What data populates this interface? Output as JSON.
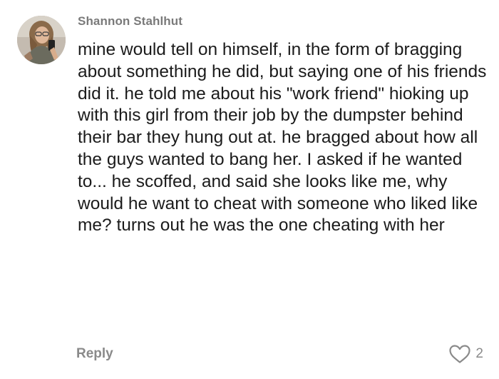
{
  "comment": {
    "author": "Shannon Stahlhut",
    "body": "mine would tell on himself, in the form of bragging about something he did, but saying one of his friends did it. he told me about his \"work friend\" hioking up with this girl from their job by the dumpster behind their bar they hung out at. he bragged about how all the guys wanted to bang her. I asked if he wanted to... he scoffed, and said she looks like me, why would he want to cheat with someone who liked like me? turns out he was the one cheating with her",
    "reply_label": "Reply",
    "like_count": "2"
  },
  "icons": {
    "avatar": "user-photo",
    "like": "heart-outline-icon"
  },
  "colors": {
    "username": "#7a7a7a",
    "body_text": "#1b1b1b",
    "action_text": "#8a8a8a",
    "heart_stroke": "#8a8a8a"
  }
}
